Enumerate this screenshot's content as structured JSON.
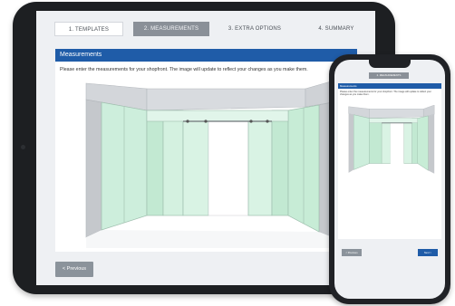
{
  "tablet": {
    "tabs": [
      {
        "label": "1. TEMPLATES"
      },
      {
        "label": "2. MEASUREMENTS"
      },
      {
        "label": "3. EXTRA OPTIONS"
      },
      {
        "label": "4. SUMMARY"
      }
    ],
    "panel_title": "Measurements",
    "instructions": "Please enter the measurements for your shopfront. The image will update to reflect your changes as you make them.",
    "previous_label": "< Previous"
  },
  "phone": {
    "tab_label": "2. MEASUREMENTS",
    "panel_title": "Measurements",
    "instructions": "Please enter the measurements for your shopfront. The image will update to reflect your changes as you make them.",
    "previous_label": "< Previous",
    "next_label": "Next >"
  },
  "colors": {
    "accent": "#1f5ca8",
    "inactive_button": "#8b939b",
    "glass": "#c9ecd9",
    "wall": "#c9ccd0"
  }
}
